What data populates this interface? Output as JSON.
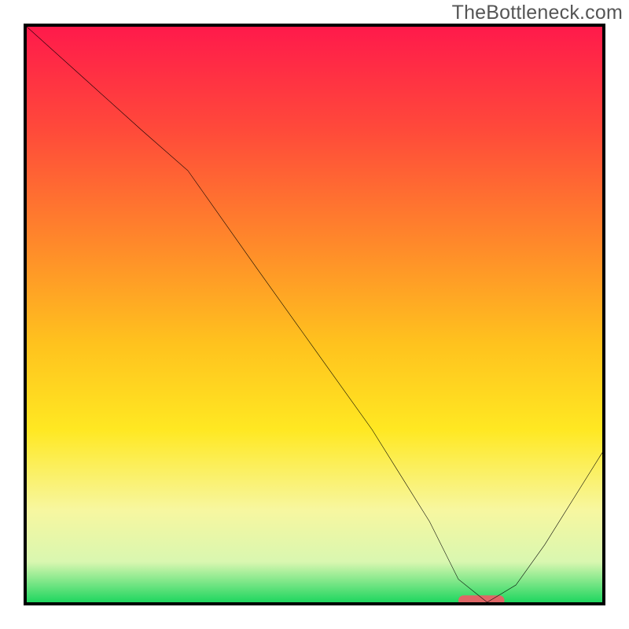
{
  "watermark": "TheBottleneck.com",
  "chart_data": {
    "type": "line",
    "title": "",
    "xlabel": "",
    "ylabel": "",
    "xlim": [
      0,
      100
    ],
    "ylim": [
      0,
      100
    ],
    "note": "Background is a vertical bottleneck heatmap: red (high bottleneck) at top through orange/yellow to green (no bottleneck) at bottom. Black curve shows bottleneck % vs. configuration index; minimum (optimal) region highlighted near x≈78.",
    "gradient_stops": [
      {
        "offset": 0,
        "color": "#ff1a4b"
      },
      {
        "offset": 18,
        "color": "#ff4a3a"
      },
      {
        "offset": 38,
        "color": "#ff8a2a"
      },
      {
        "offset": 55,
        "color": "#ffc21e"
      },
      {
        "offset": 70,
        "color": "#ffe822"
      },
      {
        "offset": 84,
        "color": "#f7f7a0"
      },
      {
        "offset": 93,
        "color": "#d9f7b0"
      },
      {
        "offset": 100,
        "color": "#1fd65f"
      }
    ],
    "curve": {
      "x": [
        0,
        10,
        20,
        28,
        40,
        50,
        60,
        70,
        75,
        80,
        85,
        90,
        100
      ],
      "y": [
        100,
        91,
        82,
        75,
        58,
        44,
        30,
        14,
        4,
        0,
        3,
        10,
        26
      ]
    },
    "optimal_marker": {
      "x_start": 75,
      "x_end": 83,
      "y": 0,
      "color": "#e06666"
    }
  }
}
